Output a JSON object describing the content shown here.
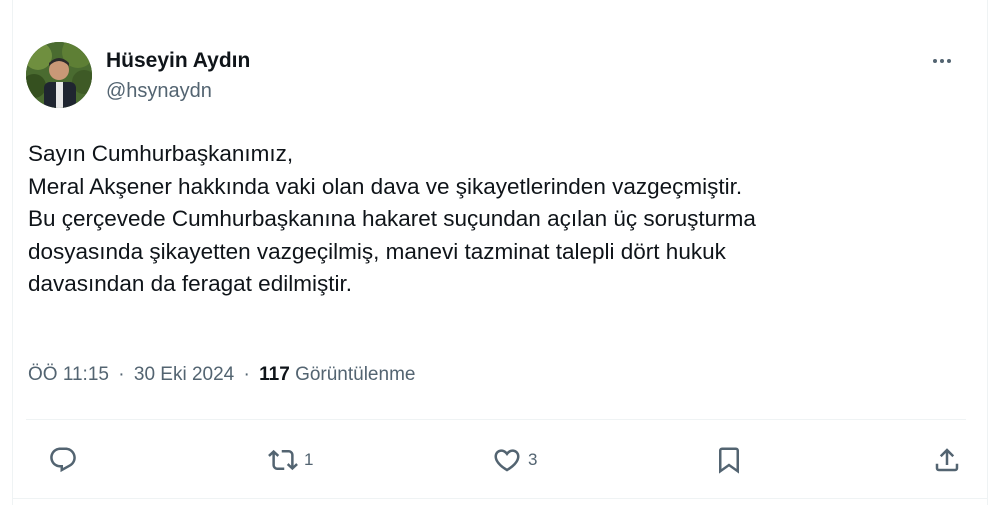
{
  "author": {
    "display_name": "Hüseyin Aydın",
    "handle": "@hsynaydn"
  },
  "tweet": {
    "text": "Sayın Cumhurbaşkanımız,\nMeral Akşener hakkında vaki olan dava ve şikayetlerinden vazgeçmiştir.\nBu çerçevede Cumhurbaşkanına hakaret suçundan açılan üç soruşturma\ndosyasında şikayetten vazgeçilmiş, manevi tazminat talepli dört hukuk\ndavasından da  feragat edilmiştir."
  },
  "meta": {
    "time": "ÖÖ 11:15",
    "separator": "·",
    "date": "30 Eki 2024",
    "views_count": "117",
    "views_label": "Görüntülenme"
  },
  "actions": {
    "reply_count": "",
    "retweet_count": "1",
    "like_count": "3"
  },
  "icons": {
    "more": "more-horizontal-icon",
    "reply": "reply-icon",
    "retweet": "retweet-icon",
    "like": "heart-icon",
    "bookmark": "bookmark-icon",
    "share": "share-icon"
  },
  "colors": {
    "text_primary": "#0f1419",
    "text_secondary": "#536471",
    "divider": "#eff3f4"
  }
}
